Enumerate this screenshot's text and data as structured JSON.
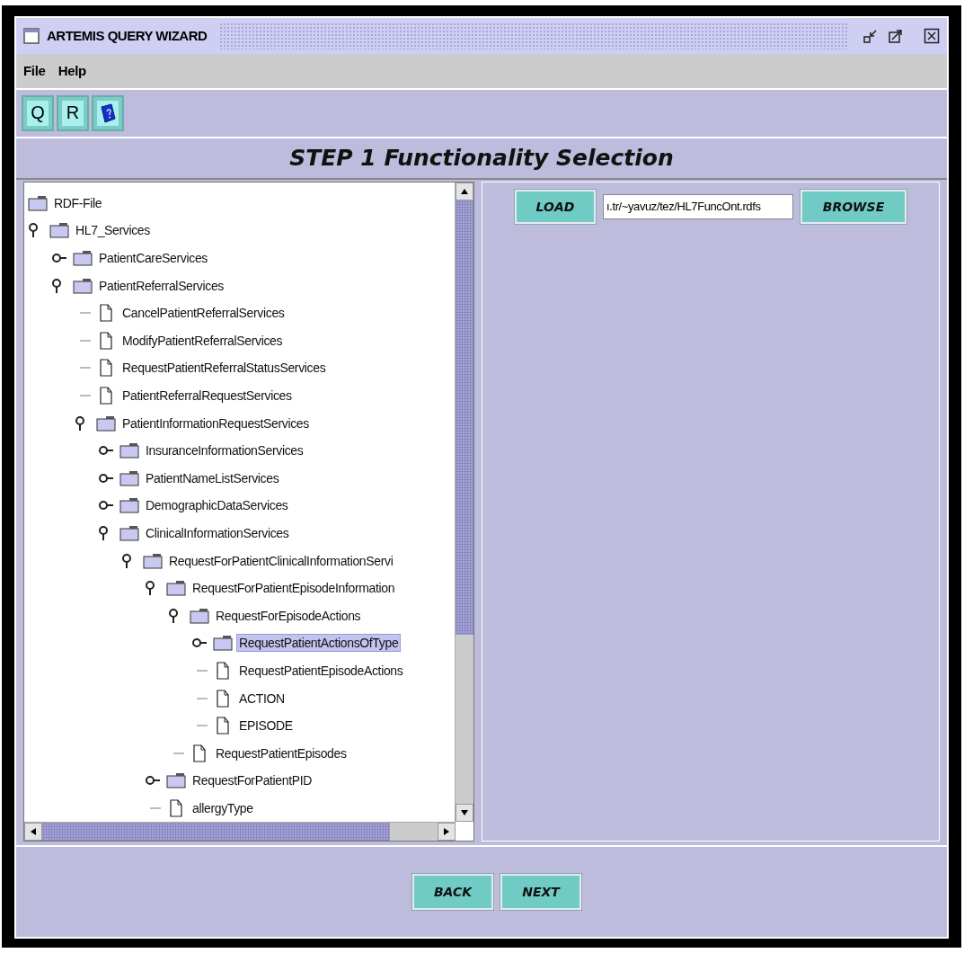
{
  "window": {
    "title": "ARTEMIS QUERY WIZARD"
  },
  "menu": [
    "File",
    "Help"
  ],
  "toolbar": [
    {
      "kind": "text",
      "label": "Q"
    },
    {
      "kind": "text",
      "label": "R"
    },
    {
      "kind": "help"
    }
  ],
  "heading": "STEP 1 Functionality Selection",
  "tree": [
    {
      "label": "RDF-File",
      "kind": "folder",
      "selected": false,
      "children": [
        {
          "label": "HL7_Services",
          "kind": "folder",
          "expanded": true,
          "selected": false,
          "children": [
            {
              "label": "PatientCareServices",
              "kind": "folder",
              "expanded": false,
              "selected": false
            },
            {
              "label": "PatientReferralServices",
              "kind": "folder",
              "expanded": true,
              "selected": false,
              "children": [
                {
                  "label": "CancelPatientReferralServices",
                  "kind": "document",
                  "selected": false
                },
                {
                  "label": "ModifyPatientReferralServices",
                  "kind": "document",
                  "selected": false
                },
                {
                  "label": "RequestPatientReferralStatusServices",
                  "kind": "document",
                  "selected": false
                },
                {
                  "label": "PatientReferralRequestServices",
                  "kind": "document",
                  "selected": false
                },
                {
                  "label": "PatientInformationRequestServices",
                  "kind": "folder",
                  "expanded": true,
                  "selected": false,
                  "children": [
                    {
                      "label": "InsuranceInformationServices",
                      "kind": "folder",
                      "expanded": false,
                      "selected": false
                    },
                    {
                      "label": "PatientNameListServices",
                      "kind": "folder",
                      "expanded": false,
                      "selected": false
                    },
                    {
                      "label": "DemographicDataServices",
                      "kind": "folder",
                      "expanded": false,
                      "selected": false
                    },
                    {
                      "label": "ClinicalInformationServices",
                      "kind": "folder",
                      "expanded": true,
                      "selected": false,
                      "children": [
                        {
                          "label": "RequestForPatientClinicalInformationServi",
                          "kind": "folder",
                          "expanded": true,
                          "selected": false,
                          "children": [
                            {
                              "label": "RequestForPatientEpisodeInformation",
                              "kind": "folder",
                              "expanded": true,
                              "selected": false,
                              "children": [
                                {
                                  "label": "RequestForEpisodeActions",
                                  "kind": "folder",
                                  "expanded": true,
                                  "selected": false,
                                  "children": [
                                    {
                                      "label": "RequestPatientActionsOfType",
                                      "kind": "folder",
                                      "expanded": false,
                                      "selected": true
                                    },
                                    {
                                      "label": "RequestPatientEpisodeActions",
                                      "kind": "document",
                                      "selected": false
                                    },
                                    {
                                      "label": "ACTION",
                                      "kind": "document",
                                      "selected": false
                                    },
                                    {
                                      "label": "EPISODE",
                                      "kind": "document",
                                      "selected": false
                                    }
                                  ]
                                },
                                {
                                  "label": "RequestPatientEpisodes",
                                  "kind": "document",
                                  "selected": false
                                }
                              ]
                            },
                            {
                              "label": "RequestForPatientPID",
                              "kind": "folder",
                              "expanded": false,
                              "selected": false
                            },
                            {
                              "label": "allergyType",
                              "kind": "document",
                              "selected": false
                            }
                          ]
                        }
                      ]
                    }
                  ]
                }
              ]
            }
          ]
        }
      ]
    }
  ],
  "load_button": "LOAD",
  "path_field": {
    "value": "ı.tr/~yavuz/tez/HL7FuncOnt.rdfs"
  },
  "browse_button": "BROWSE",
  "buttons": [
    "BACK",
    "NEXT"
  ]
}
